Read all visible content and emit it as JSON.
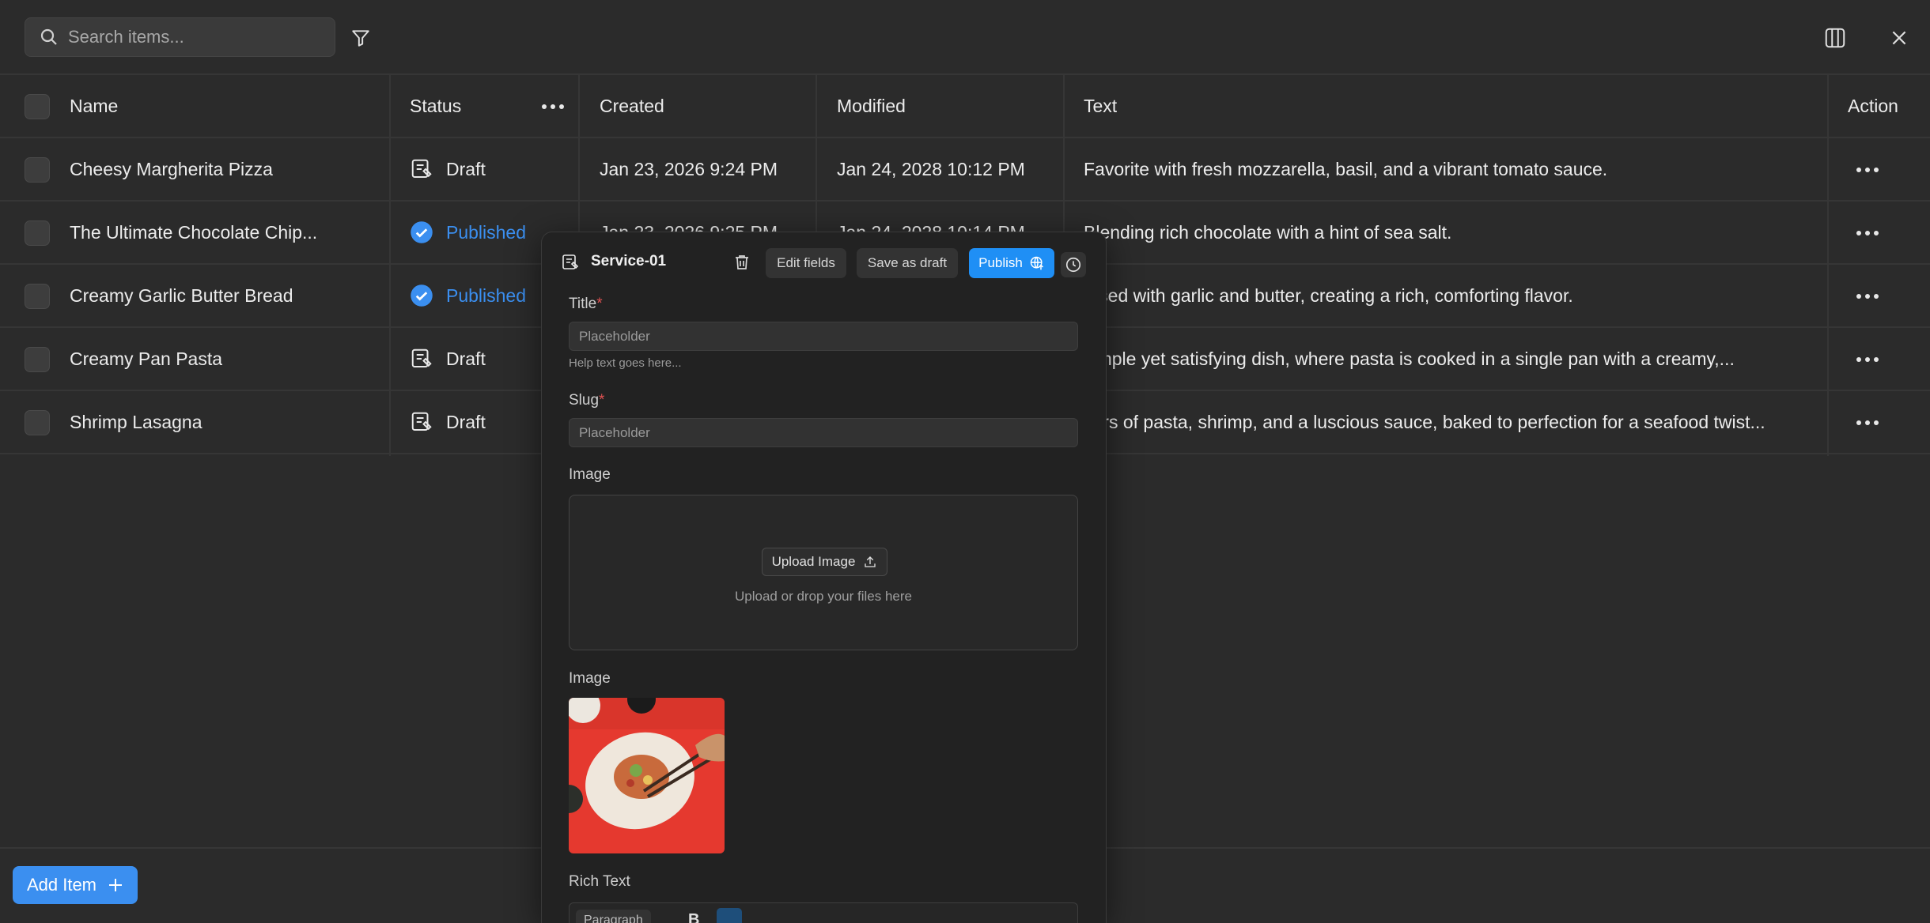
{
  "toolbar": {
    "search_placeholder": "Search items...",
    "filter_icon": "filter-icon",
    "columns_icon": "columns-icon",
    "close_icon": "close-icon"
  },
  "table": {
    "columns": [
      "Name",
      "Status",
      "Created",
      "Modified",
      "Text",
      "Action"
    ],
    "rows": [
      {
        "name": "Cheesy Margherita Pizza",
        "status": "Draft",
        "created": "Jan 23, 2026  9:24 PM",
        "modified": "Jan 24, 2028  10:12 PM",
        "text": "Favorite with fresh mozzarella, basil, and a vibrant tomato sauce."
      },
      {
        "name": "The Ultimate Chocolate Chip...",
        "status": "Published",
        "created": "Jan 23, 2026  9:25 PM",
        "modified": "Jan 24, 2028  10:14 PM",
        "text": "Blending rich chocolate with a hint of sea salt."
      },
      {
        "name": "Creamy Garlic Butter Bread",
        "status": "Published",
        "created": "",
        "modified": "",
        "text": "fused with garlic and butter, creating a rich, comforting flavor."
      },
      {
        "name": "Creamy Pan Pasta",
        "status": "Draft",
        "created": "",
        "modified": "",
        "text": "simple yet satisfying dish, where pasta is cooked in a single pan with a creamy,..."
      },
      {
        "name": "Shrimp Lasagna",
        "status": "Draft",
        "created": "",
        "modified": "",
        "text": "yers of pasta, shrimp, and a luscious sauce, baked to perfection for a seafood twist..."
      }
    ]
  },
  "footer": {
    "add_label": "Add Item"
  },
  "panel": {
    "title": "Service-01",
    "edit_fields": "Edit fields",
    "save_draft": "Save as draft",
    "publish": "Publish",
    "fields": {
      "title_label": "Title",
      "title_placeholder": "Placeholder",
      "title_help": "Help text goes here...",
      "slug_label": "Slug",
      "slug_placeholder": "Placeholder",
      "image_label": "Image",
      "upload_button": "Upload Image",
      "upload_hint": "Upload or drop your files here",
      "image2_label": "Image",
      "rich_text_label": "Rich Text",
      "rich_text_style": "Paragraph"
    },
    "required_mark": "*"
  },
  "colors": {
    "background": "#2b2b2b",
    "accent": "#3b8ff0",
    "publish": "#1f8ff5",
    "panel": "#222222"
  }
}
